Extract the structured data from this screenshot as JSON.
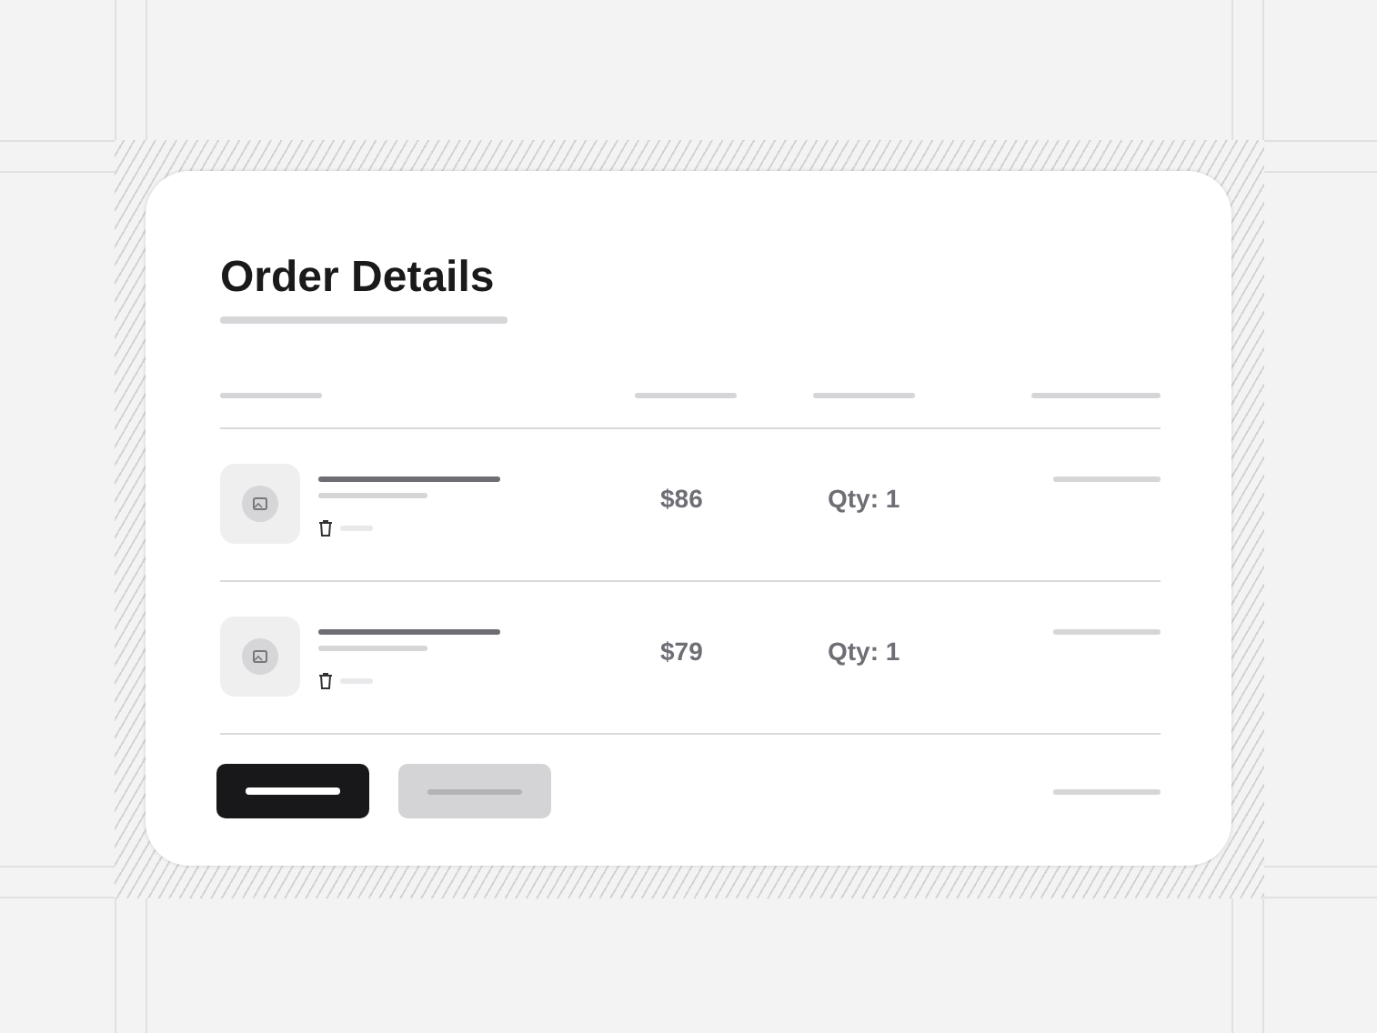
{
  "card": {
    "title": "Order Details"
  },
  "items": [
    {
      "price": "$86",
      "quantity": "Qty: 1"
    },
    {
      "price": "$79",
      "quantity": "Qty: 1"
    }
  ]
}
